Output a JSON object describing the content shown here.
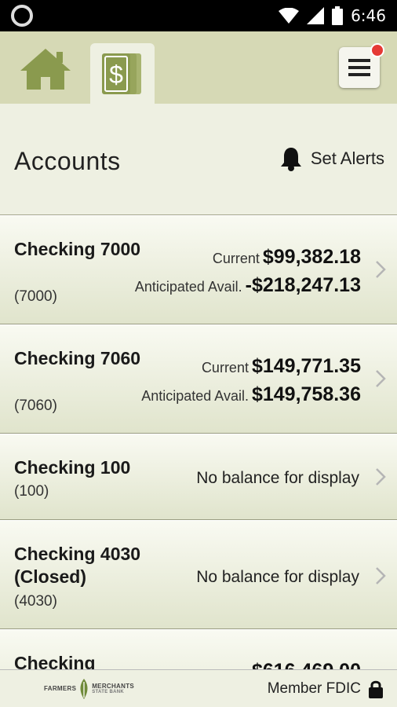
{
  "status_bar": {
    "time": "6:46"
  },
  "header": {
    "title": "Accounts",
    "alerts_label": "Set Alerts"
  },
  "accounts": [
    {
      "name": "Checking 7000",
      "number": "(7000)",
      "current_label": "Current",
      "current_value": "$99,382.18",
      "anticipated_label": "Anticipated Avail.",
      "anticipated_value": "-$218,247.13"
    },
    {
      "name": "Checking 7060",
      "number": "(7060)",
      "current_label": "Current",
      "current_value": "$149,771.35",
      "anticipated_label": "Anticipated Avail.",
      "anticipated_value": "$149,758.36"
    },
    {
      "name": "Checking 100",
      "number": "(100)",
      "no_balance": "No balance for display"
    },
    {
      "name": "Checking 4030 (Closed)",
      "number": "(4030)",
      "no_balance": "No balance for display"
    },
    {
      "name": "Checking",
      "current_value": "$616,469.00"
    }
  ],
  "footer": {
    "logo_text_left": "FARMERS",
    "logo_text_right": "MERCHANTS",
    "logo_sub": "STATE BANK",
    "fdic": "Member FDIC"
  },
  "colors": {
    "brand_green": "#8a9a4e",
    "nav_bg": "#d6d9b5",
    "page_bg": "#eef0e2",
    "badge_red": "#e53935"
  },
  "icons": {
    "home": "home-icon",
    "accounts": "dollar-accounts-icon",
    "menu": "hamburger-menu-icon",
    "alerts": "bell-icon",
    "chevron": "chevron-right-icon",
    "lock": "lock-icon"
  }
}
